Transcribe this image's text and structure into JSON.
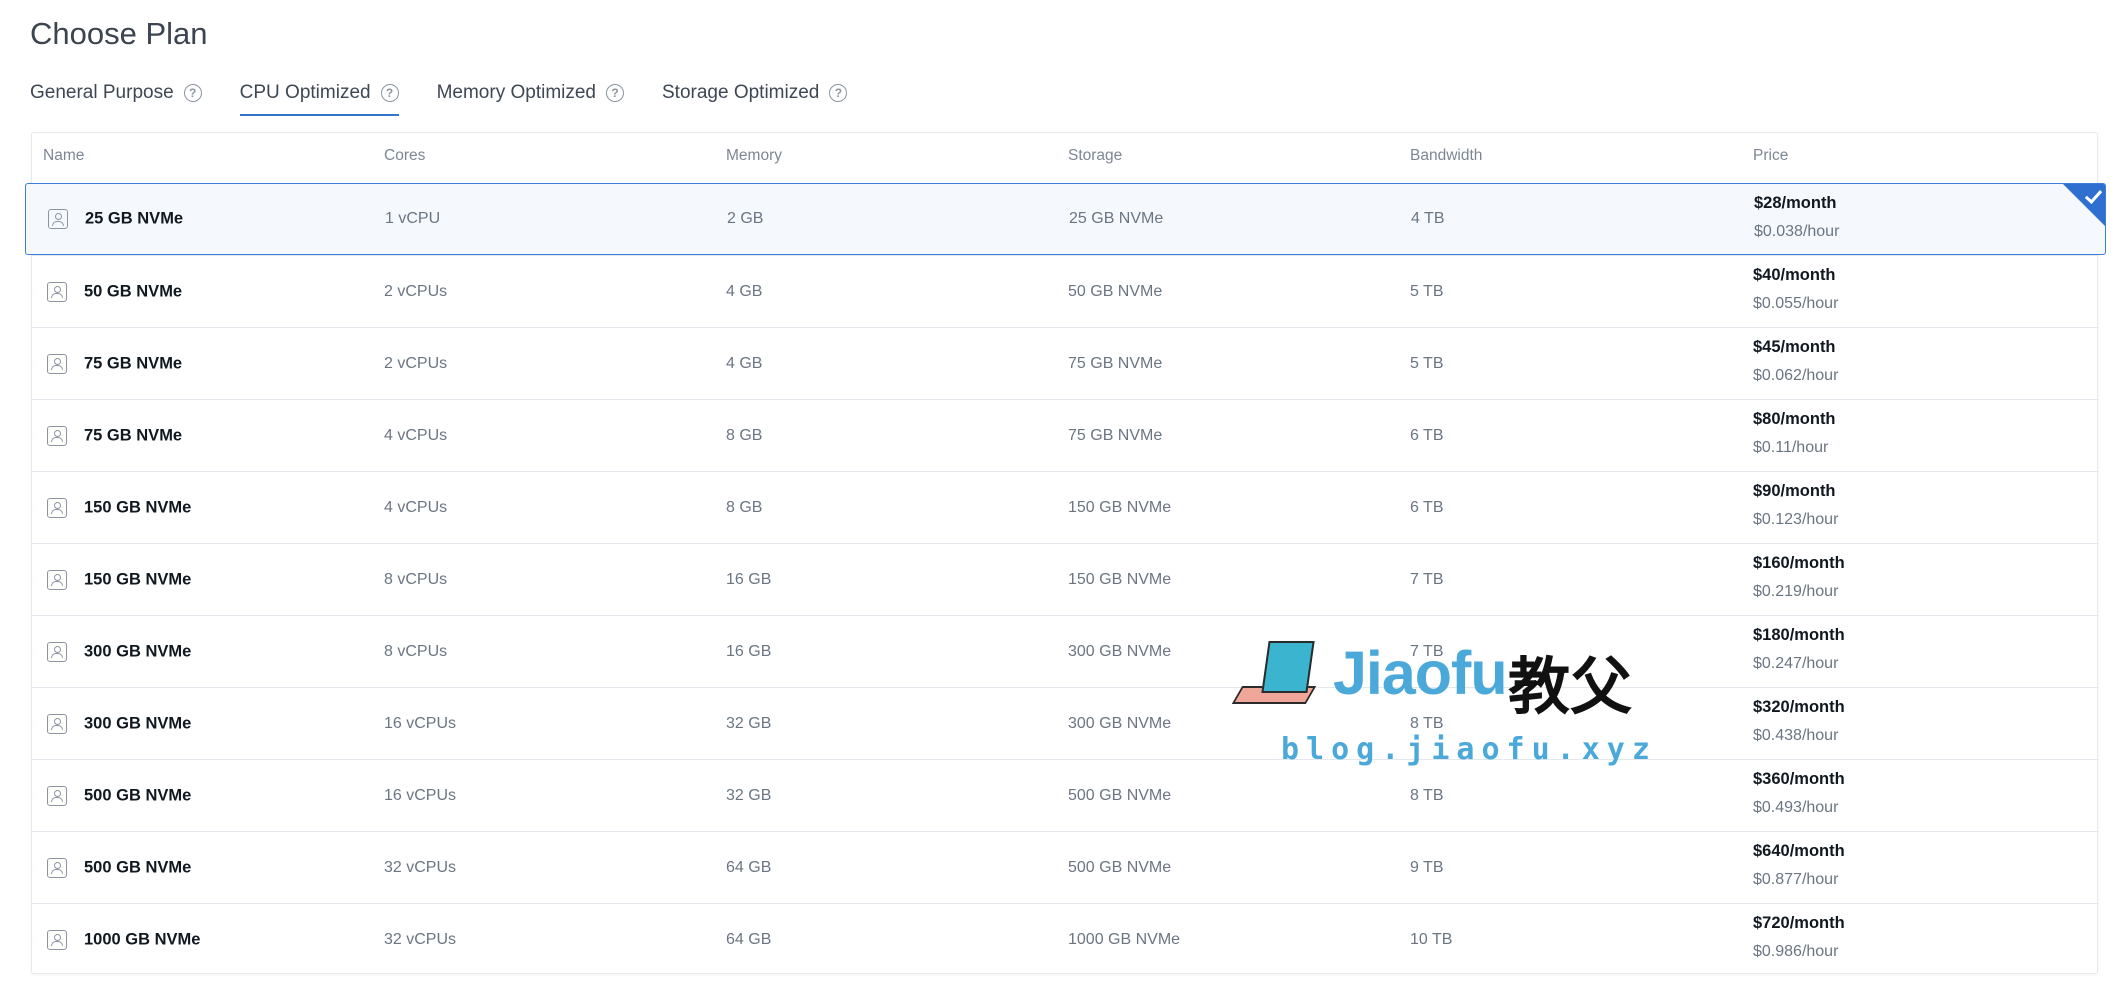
{
  "page": {
    "title": "Choose Plan"
  },
  "tabs": [
    {
      "label": "General Purpose",
      "active": false
    },
    {
      "label": "CPU Optimized",
      "active": true
    },
    {
      "label": "Memory Optimized",
      "active": false
    },
    {
      "label": "Storage Optimized",
      "active": false
    }
  ],
  "help_icon": "question-circle-icon",
  "table": {
    "columns": [
      "Name",
      "Cores",
      "Memory",
      "Storage",
      "Bandwidth",
      "Price"
    ],
    "rows": [
      {
        "name": "25 GB NVMe",
        "cores": "1 vCPU",
        "memory": "2 GB",
        "storage": "25 GB NVMe",
        "bandwidth": "4 TB",
        "price_month": "$28/month",
        "price_hour": "$0.038/hour",
        "selected": true
      },
      {
        "name": "50 GB NVMe",
        "cores": "2 vCPUs",
        "memory": "4 GB",
        "storage": "50 GB NVMe",
        "bandwidth": "5 TB",
        "price_month": "$40/month",
        "price_hour": "$0.055/hour",
        "selected": false
      },
      {
        "name": "75 GB NVMe",
        "cores": "2 vCPUs",
        "memory": "4 GB",
        "storage": "75 GB NVMe",
        "bandwidth": "5 TB",
        "price_month": "$45/month",
        "price_hour": "$0.062/hour",
        "selected": false
      },
      {
        "name": "75 GB NVMe",
        "cores": "4 vCPUs",
        "memory": "8 GB",
        "storage": "75 GB NVMe",
        "bandwidth": "6 TB",
        "price_month": "$80/month",
        "price_hour": "$0.11/hour",
        "selected": false
      },
      {
        "name": "150 GB NVMe",
        "cores": "4 vCPUs",
        "memory": "8 GB",
        "storage": "150 GB NVMe",
        "bandwidth": "6 TB",
        "price_month": "$90/month",
        "price_hour": "$0.123/hour",
        "selected": false
      },
      {
        "name": "150 GB NVMe",
        "cores": "8 vCPUs",
        "memory": "16 GB",
        "storage": "150 GB NVMe",
        "bandwidth": "7 TB",
        "price_month": "$160/month",
        "price_hour": "$0.219/hour",
        "selected": false
      },
      {
        "name": "300 GB NVMe",
        "cores": "8 vCPUs",
        "memory": "16 GB",
        "storage": "300 GB NVMe",
        "bandwidth": "7 TB",
        "price_month": "$180/month",
        "price_hour": "$0.247/hour",
        "selected": false
      },
      {
        "name": "300 GB NVMe",
        "cores": "16 vCPUs",
        "memory": "32 GB",
        "storage": "300 GB NVMe",
        "bandwidth": "8 TB",
        "price_month": "$320/month",
        "price_hour": "$0.438/hour",
        "selected": false
      },
      {
        "name": "500 GB NVMe",
        "cores": "16 vCPUs",
        "memory": "32 GB",
        "storage": "500 GB NVMe",
        "bandwidth": "8 TB",
        "price_month": "$360/month",
        "price_hour": "$0.493/hour",
        "selected": false
      },
      {
        "name": "500 GB NVMe",
        "cores": "32 vCPUs",
        "memory": "64 GB",
        "storage": "500 GB NVMe",
        "bandwidth": "9 TB",
        "price_month": "$640/month",
        "price_hour": "$0.877/hour",
        "selected": false
      },
      {
        "name": "1000 GB NVMe",
        "cores": "32 vCPUs",
        "memory": "64 GB",
        "storage": "1000 GB NVMe",
        "bandwidth": "10 TB",
        "price_month": "$720/month",
        "price_hour": "$0.986/hour",
        "selected": false
      }
    ]
  },
  "watermark": {
    "brand": "Jiaofu",
    "brand_cn": "教父",
    "url": "blog.jiaofu.xyz"
  },
  "colors": {
    "accent": "#3176cc",
    "selected_bg": "#f5f9fd",
    "watermark_blue": "#4aa9d9"
  }
}
